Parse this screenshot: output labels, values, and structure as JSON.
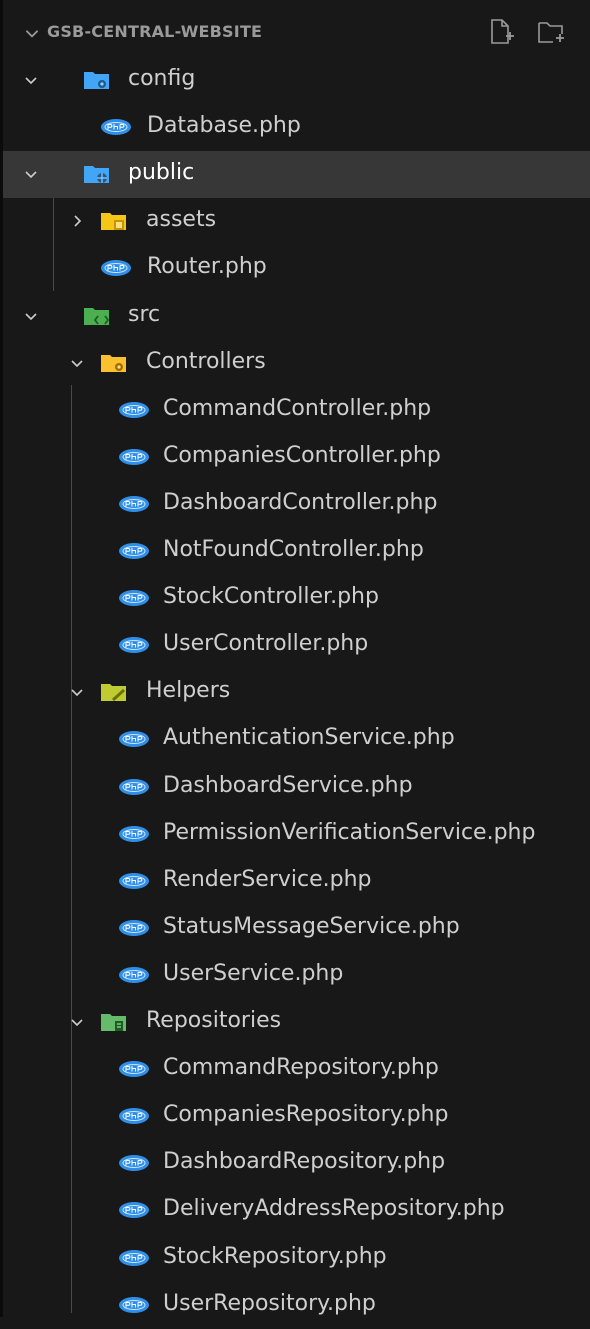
{
  "explorer": {
    "section_title": "GSB-CENTRAL-WEBSITE",
    "actions": [
      "new-file-icon",
      "new-folder-icon"
    ],
    "tree": [
      {
        "label": "config",
        "type": "folder",
        "expanded": true,
        "icon": "folder-config-icon"
      },
      {
        "label": "Database.php",
        "type": "file",
        "icon": "php-icon"
      },
      {
        "label": "public",
        "type": "folder",
        "expanded": true,
        "active": true,
        "icon": "folder-public-icon"
      },
      {
        "label": "assets",
        "type": "folder",
        "expanded": false,
        "icon": "folder-assets-icon"
      },
      {
        "label": "Router.php",
        "type": "file",
        "icon": "php-icon"
      },
      {
        "label": "src",
        "type": "folder",
        "expanded": true,
        "icon": "folder-src-icon"
      },
      {
        "label": "Controllers",
        "type": "folder",
        "expanded": true,
        "icon": "folder-controllers-icon"
      },
      {
        "label": "CommandController.php",
        "type": "file",
        "icon": "php-icon"
      },
      {
        "label": "CompaniesController.php",
        "type": "file",
        "icon": "php-icon"
      },
      {
        "label": "DashboardController.php",
        "type": "file",
        "icon": "php-icon"
      },
      {
        "label": "NotFoundController.php",
        "type": "file",
        "icon": "php-icon"
      },
      {
        "label": "StockController.php",
        "type": "file",
        "icon": "php-icon"
      },
      {
        "label": "UserController.php",
        "type": "file",
        "icon": "php-icon"
      },
      {
        "label": "Helpers",
        "type": "folder",
        "expanded": true,
        "icon": "folder-helpers-icon"
      },
      {
        "label": "AuthenticationService.php",
        "type": "file",
        "icon": "php-icon"
      },
      {
        "label": "DashboardService.php",
        "type": "file",
        "icon": "php-icon"
      },
      {
        "label": "PermissionVerificationService.php",
        "type": "file",
        "icon": "php-icon"
      },
      {
        "label": "RenderService.php",
        "type": "file",
        "icon": "php-icon"
      },
      {
        "label": "StatusMessageService.php",
        "type": "file",
        "icon": "php-icon"
      },
      {
        "label": "UserService.php",
        "type": "file",
        "icon": "php-icon"
      },
      {
        "label": "Repositories",
        "type": "folder",
        "expanded": true,
        "icon": "folder-repositories-icon"
      },
      {
        "label": "CommandRepository.php",
        "type": "file",
        "icon": "php-icon"
      },
      {
        "label": "CompaniesRepository.php",
        "type": "file",
        "icon": "php-icon"
      },
      {
        "label": "DashboardRepository.php",
        "type": "file",
        "icon": "php-icon"
      },
      {
        "label": "DeliveryAddressRepository.php",
        "type": "file",
        "icon": "php-icon"
      },
      {
        "label": "StockRepository.php",
        "type": "file",
        "icon": "php-icon"
      },
      {
        "label": "UserRepository.php",
        "type": "file",
        "icon": "php-icon"
      }
    ]
  },
  "colors": {
    "background": "#181818",
    "active_row": "#373737",
    "php_icon": "#2f8fe8",
    "folder_config": "#42a5f5",
    "folder_public": "#42a5f5",
    "folder_assets": "#f5c518",
    "folder_src": "#4caf50",
    "folder_controllers": "#fbc02d",
    "folder_helpers": "#c0ca33",
    "folder_repositories": "#66bb6a"
  }
}
